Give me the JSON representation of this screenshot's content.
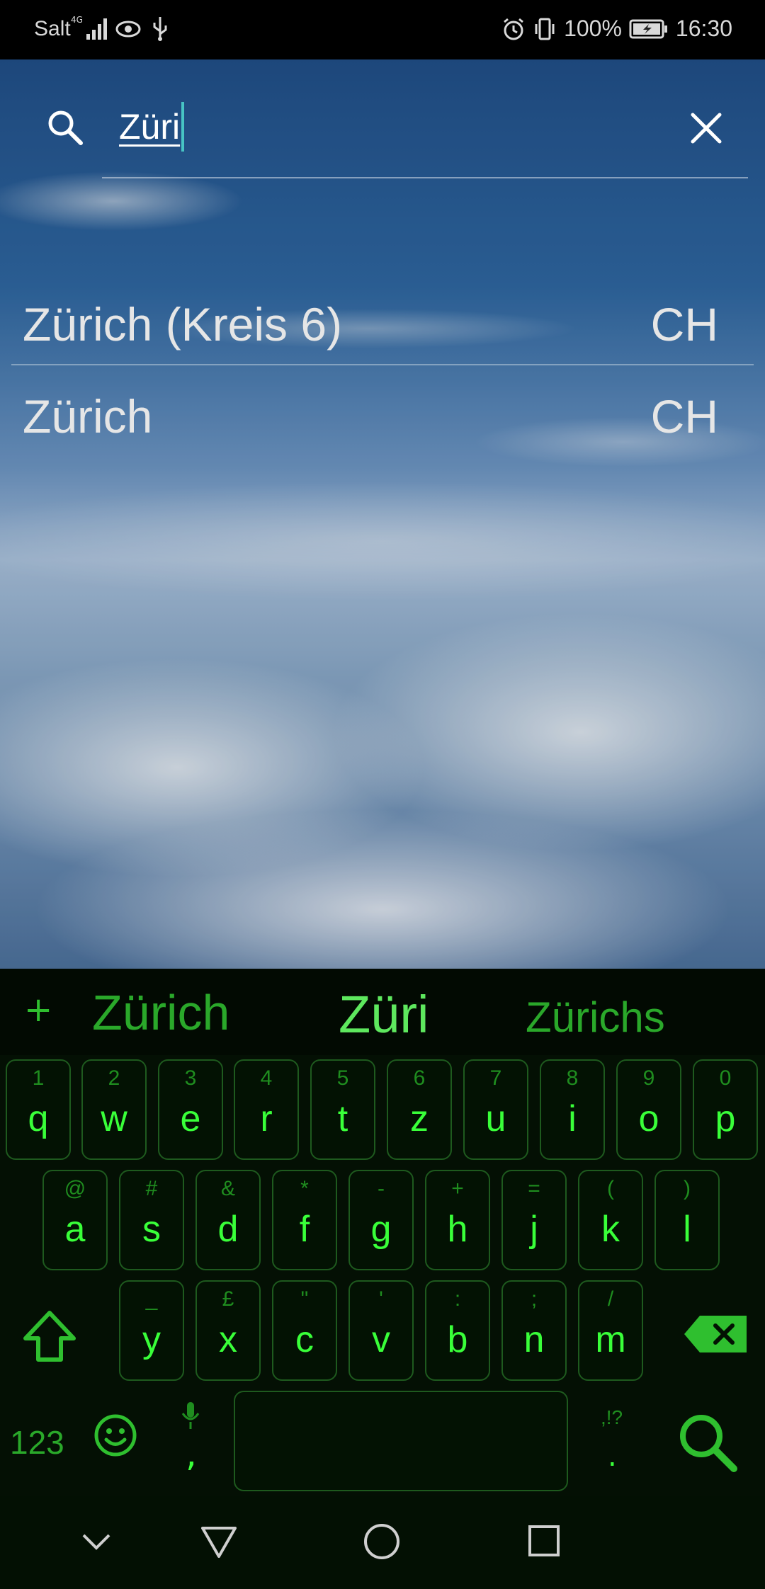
{
  "status_bar": {
    "carrier": "Salt",
    "battery_pct": "100%",
    "time": "16:30"
  },
  "search": {
    "query": "Züri",
    "icon": "search-icon",
    "clear_icon": "close-icon"
  },
  "results": [
    {
      "name": "Zürich (Kreis 6)",
      "country": "CH"
    },
    {
      "name": "Zürich",
      "country": "CH"
    }
  ],
  "keyboard": {
    "suggestions": [
      "Zürich",
      "Züri",
      "Zürichs"
    ],
    "suggestion_add": "+",
    "row1": [
      {
        "hint": "1",
        "key": "q"
      },
      {
        "hint": "2",
        "key": "w"
      },
      {
        "hint": "3",
        "key": "e"
      },
      {
        "hint": "4",
        "key": "r"
      },
      {
        "hint": "5",
        "key": "t"
      },
      {
        "hint": "6",
        "key": "z"
      },
      {
        "hint": "7",
        "key": "u"
      },
      {
        "hint": "8",
        "key": "i"
      },
      {
        "hint": "9",
        "key": "o"
      },
      {
        "hint": "0",
        "key": "p"
      }
    ],
    "row2": [
      {
        "hint": "@",
        "key": "a"
      },
      {
        "hint": "#",
        "key": "s"
      },
      {
        "hint": "&",
        "key": "d"
      },
      {
        "hint": "*",
        "key": "f"
      },
      {
        "hint": "-",
        "key": "g"
      },
      {
        "hint": "+",
        "key": "h"
      },
      {
        "hint": "=",
        "key": "j"
      },
      {
        "hint": "(",
        "key": "k"
      },
      {
        "hint": ")",
        "key": "l"
      }
    ],
    "row3": [
      {
        "hint": "_",
        "key": "y"
      },
      {
        "hint": "£",
        "key": "x"
      },
      {
        "hint": "\"",
        "key": "c"
      },
      {
        "hint": "'",
        "key": "v"
      },
      {
        "hint": ":",
        "key": "b"
      },
      {
        "hint": ";",
        "key": "n"
      },
      {
        "hint": "/",
        "key": "m"
      }
    ],
    "numbers_label": "123",
    "comma_label": ",",
    "punct_hint": ",!?",
    "period_label": ".",
    "accent_color": "#39ff39"
  },
  "nav": {
    "icons": [
      "chevron-down-icon",
      "back-icon",
      "home-icon",
      "recents-icon"
    ]
  }
}
